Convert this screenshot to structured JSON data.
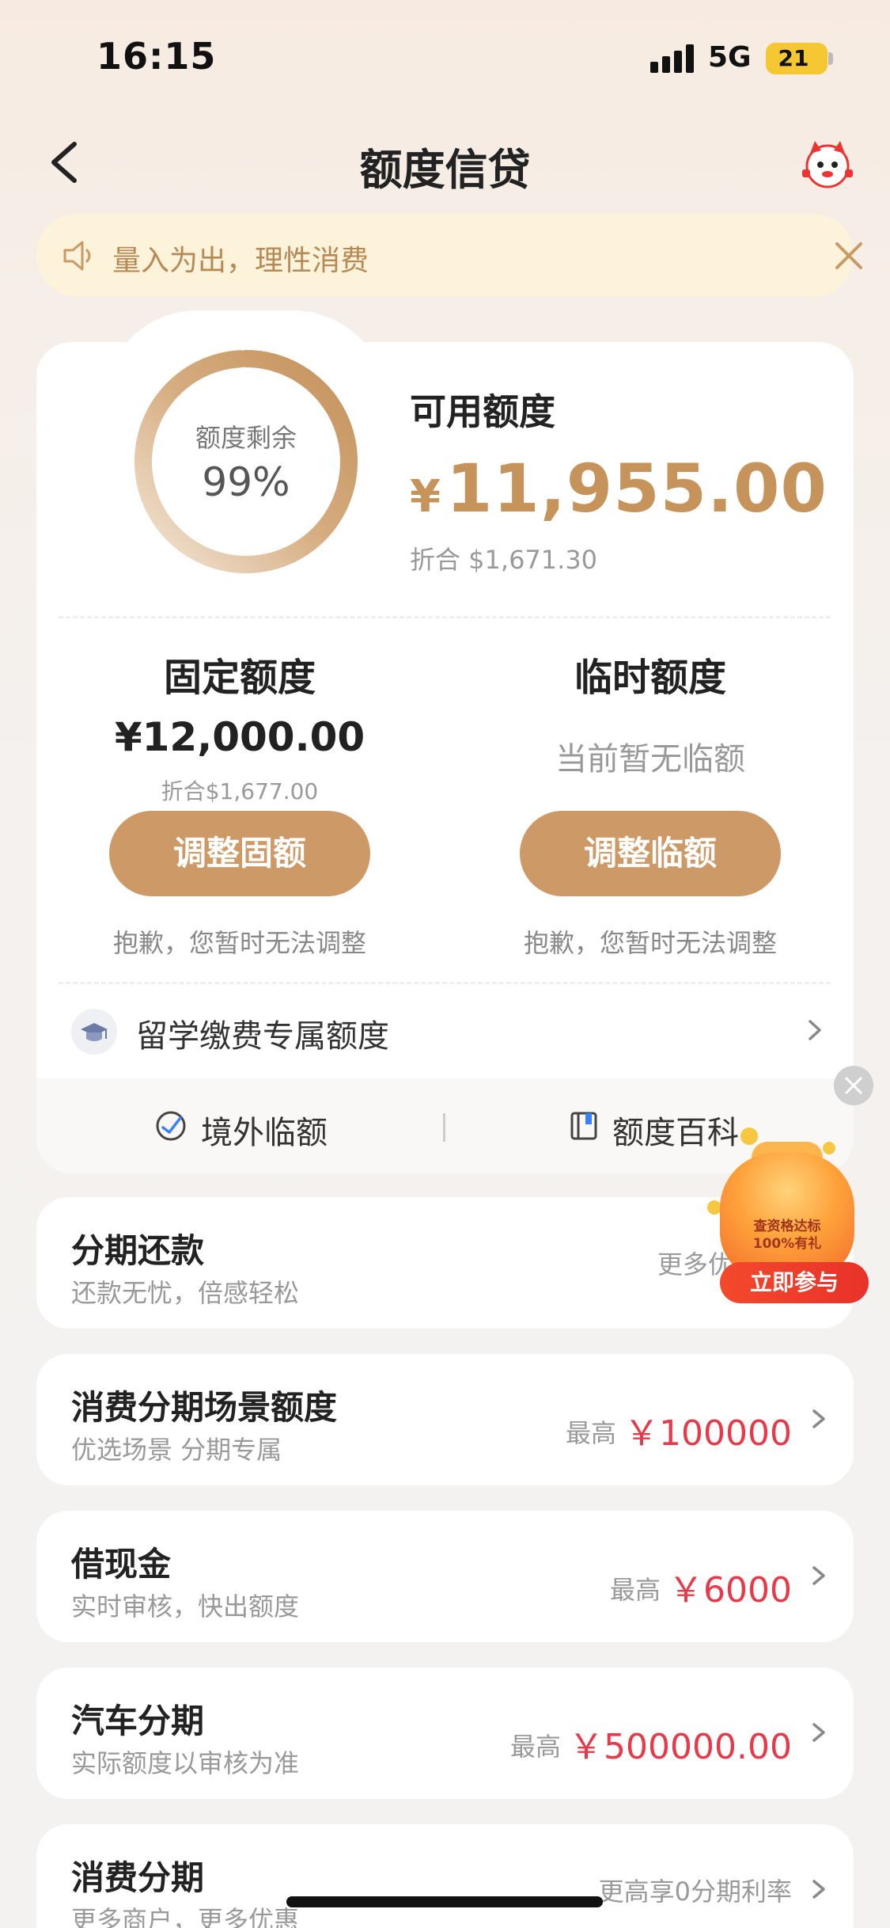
{
  "status_bar": {
    "time": "16:15",
    "network": "5G",
    "battery": "21"
  },
  "nav": {
    "title": "额度信贷"
  },
  "notice": {
    "text": "量入为出，理性消费"
  },
  "quota": {
    "ring_label": "额度剩余",
    "ring_value": "99%",
    "remaining_fraction": 0.99,
    "available_label": "可用额度",
    "currency": "¥",
    "available_amount": "11,955.00",
    "available_conversion": "折合  $1,671.30"
  },
  "fixed": {
    "title": "固定额度",
    "amount": "¥12,000.00",
    "conversion": "折合$1,677.00",
    "button": "调整固额",
    "note": "抱歉，您暂时无法调整"
  },
  "temporary": {
    "title": "临时额度",
    "status": "当前暂无临额",
    "button": "调整临额",
    "note": "抱歉，您暂时无法调整"
  },
  "study_abroad": {
    "label": "留学缴费专属额度"
  },
  "footer_links": [
    {
      "label": "境外临额"
    },
    {
      "label": "额度百科"
    }
  ],
  "list_cards": [
    {
      "title": "分期还款",
      "subtitle": "还款无忧，倍感轻松",
      "right_prefix": "更多优惠  戳我",
      "right_value": ""
    },
    {
      "title": "消费分期场景额度",
      "subtitle": "优选场景 分期专属",
      "right_prefix": "最高",
      "right_value": "￥100000"
    },
    {
      "title": "借现金",
      "subtitle": "实时审核，快出额度",
      "right_prefix": "最高",
      "right_value": "￥6000"
    },
    {
      "title": "汽车分期",
      "subtitle": "实际额度以审核为准",
      "right_prefix": "最高",
      "right_value": "￥500000.00"
    },
    {
      "title": "消费分期",
      "subtitle": "更多商户，更多优惠",
      "right_prefix": "更高享0分期利率",
      "right_value": ""
    }
  ],
  "promo": {
    "bag_text_line1": "查资格达标",
    "bag_text_line2": "100%有礼",
    "button": "立即参与"
  },
  "colors": {
    "gold": "#c6935a",
    "gold_button": "#cd9a67",
    "red": "#e8394a",
    "notice_bg": "#fdf2da"
  }
}
